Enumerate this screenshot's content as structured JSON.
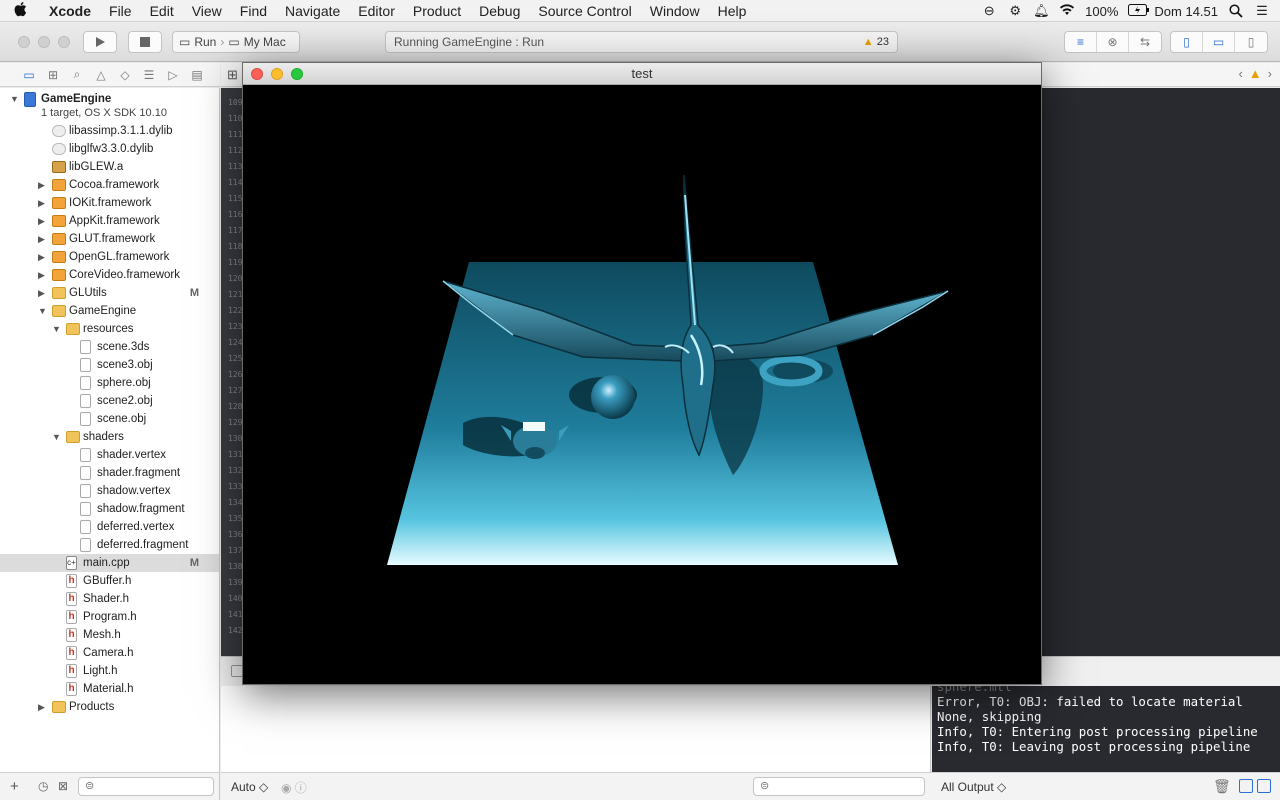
{
  "menubar": {
    "apple": "",
    "app_name": "Xcode",
    "menus": [
      "File",
      "Edit",
      "View",
      "Find",
      "Navigate",
      "Editor",
      "Product",
      "Debug",
      "Source Control",
      "Window",
      "Help"
    ],
    "battery": "100%",
    "clock": "Dom 14.51"
  },
  "toolbar": {
    "scheme_run": "Run",
    "scheme_dest": "My Mac",
    "activity_text": "Running GameEngine : Run",
    "warning_count": "23"
  },
  "navigator": {
    "project_name": "GameEngine",
    "project_subtitle": "1 target, OS X SDK 10.10",
    "items": [
      {
        "label": "libassimp.3.1.1.dylib",
        "icon": "library-icon"
      },
      {
        "label": "libglfw3.3.0.dylib",
        "icon": "library-icon"
      },
      {
        "label": "libGLEW.a",
        "icon": "static-library-icon"
      },
      {
        "label": "Cocoa.framework",
        "icon": "framework-icon"
      },
      {
        "label": "IOKit.framework",
        "icon": "framework-icon"
      },
      {
        "label": "AppKit.framework",
        "icon": "framework-icon"
      },
      {
        "label": "GLUT.framework",
        "icon": "framework-icon"
      },
      {
        "label": "OpenGL.framework",
        "icon": "framework-icon"
      },
      {
        "label": "CoreVideo.framework",
        "icon": "framework-icon"
      },
      {
        "label": "GLUtils",
        "icon": "folder-icon",
        "badge": "M"
      },
      {
        "label": "GameEngine",
        "icon": "folder-icon"
      },
      {
        "label": "resources",
        "icon": "folder-icon"
      },
      {
        "label": "scene.3ds",
        "icon": "file-icon"
      },
      {
        "label": "scene3.obj",
        "icon": "file-icon"
      },
      {
        "label": "sphere.obj",
        "icon": "file-icon"
      },
      {
        "label": "scene2.obj",
        "icon": "file-icon"
      },
      {
        "label": "scene.obj",
        "icon": "file-icon"
      },
      {
        "label": "shaders",
        "icon": "folder-icon"
      },
      {
        "label": "shader.vertex",
        "icon": "file-icon"
      },
      {
        "label": "shader.fragment",
        "icon": "file-icon"
      },
      {
        "label": "shadow.vertex",
        "icon": "file-icon"
      },
      {
        "label": "shadow.fragment",
        "icon": "file-icon"
      },
      {
        "label": "deferred.vertex",
        "icon": "file-icon"
      },
      {
        "label": "deferred.fragment",
        "icon": "file-icon"
      },
      {
        "label": "main.cpp",
        "icon": "cpp-file-icon",
        "badge": "M"
      },
      {
        "label": "GBuffer.h",
        "icon": "header-file-icon"
      },
      {
        "label": "Shader.h",
        "icon": "header-file-icon"
      },
      {
        "label": "Program.h",
        "icon": "header-file-icon"
      },
      {
        "label": "Mesh.h",
        "icon": "header-file-icon"
      },
      {
        "label": "Camera.h",
        "icon": "header-file-icon"
      },
      {
        "label": "Light.h",
        "icon": "header-file-icon"
      },
      {
        "label": "Material.h",
        "icon": "header-file-icon"
      },
      {
        "label": "Products",
        "icon": "folder-icon"
      }
    ],
    "cpp_icon_text": "c+",
    "header_icon_text": "h"
  },
  "editor": {
    "line_numbers": [
      "109",
      "110",
      "111",
      "112",
      "113",
      "114",
      "115",
      "116",
      "117",
      "118",
      "119",
      "120",
      "121",
      "122",
      "123",
      "124",
      "125",
      "126",
      "127",
      "128",
      "129",
      "130",
      "131",
      "132",
      "133",
      "134",
      "135",
      "136",
      "137",
      "138",
      "139",
      "140",
      "141",
      "142"
    ]
  },
  "console": {
    "lines": [
      "sphere.mtl",
      "Error, T0: OBJ: failed to locate material",
      "None, skipping",
      "Info,  T0: Entering post processing pipeline",
      "Info,  T0: Leaving post processing pipeline"
    ]
  },
  "bottombar": {
    "auto_label": "Auto ◇",
    "output_label": "All Output ◇"
  },
  "game_window": {
    "title": "test"
  },
  "colors": {
    "accent": "#2a6fd6",
    "warning": "#e8a000",
    "scene_cyan": "#2a8fb0"
  }
}
